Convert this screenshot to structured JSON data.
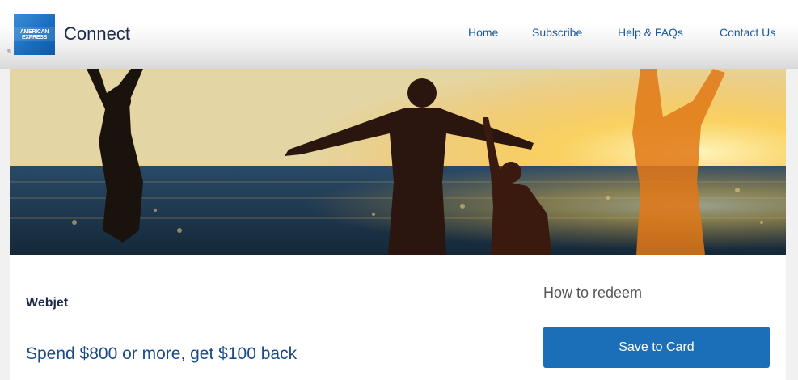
{
  "header": {
    "logo": {
      "line1": "AMERICAN",
      "line2": "EXPRESS",
      "reg_mark": "®"
    },
    "brand": "Connect",
    "nav": [
      {
        "label": "Home"
      },
      {
        "label": "Subscribe"
      },
      {
        "label": "Help & FAQs"
      },
      {
        "label": "Contact Us"
      }
    ]
  },
  "offer": {
    "merchant": "Webjet",
    "headline": "Spend $800 or more, get $100 back",
    "redeem_label": "How to redeem",
    "save_button": "Save to Card"
  },
  "colors": {
    "accent": "#1a6fb8",
    "nav_link": "#1a5a9e",
    "text_dark": "#1c2b4a",
    "offer_text": "#1a4a8a"
  }
}
